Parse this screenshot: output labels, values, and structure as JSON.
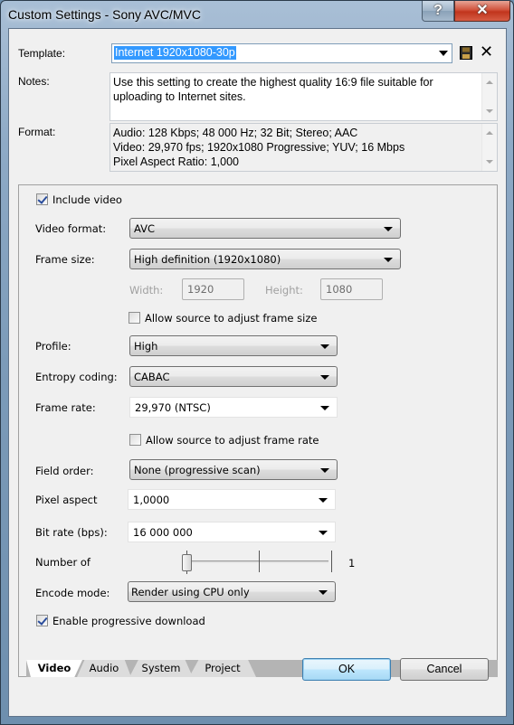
{
  "window": {
    "title": "Custom Settings - Sony AVC/MVC",
    "help_glyph": "?",
    "close_glyph": "✕"
  },
  "template": {
    "label": "Template:",
    "value": "Internet 1920x1080-30p",
    "save_icon": "floppy-disk-icon",
    "delete_icon": "delete-x-icon",
    "delete_glyph": "✕"
  },
  "notes": {
    "label": "Notes:",
    "text": "Use this setting to create the highest quality 16:9 file suitable for uploading to Internet sites."
  },
  "format": {
    "label": "Format:",
    "lines": [
      "Audio: 128 Kbps; 48 000 Hz; 32 Bit; Stereo; AAC",
      "Video: 29,970 fps; 1920x1080 Progressive; YUV; 16 Mbps",
      "Pixel Aspect Ratio: 1,000"
    ]
  },
  "video": {
    "include_video": {
      "label": "Include video",
      "checked": true
    },
    "video_format": {
      "label": "Video format:",
      "value": "AVC"
    },
    "frame_size": {
      "label": "Frame size:",
      "value": "High definition (1920x1080)"
    },
    "width": {
      "label": "Width:",
      "value": "1920"
    },
    "height": {
      "label": "Height:",
      "value": "1080"
    },
    "allow_frame_size": {
      "label": "Allow source to adjust frame size",
      "checked": false
    },
    "profile": {
      "label": "Profile:",
      "value": "High"
    },
    "entropy_coding": {
      "label": "Entropy coding:",
      "value": "CABAC"
    },
    "frame_rate": {
      "label": "Frame rate:",
      "value": "29,970 (NTSC)"
    },
    "allow_frame_rate": {
      "label": "Allow source to adjust frame rate",
      "checked": false
    },
    "field_order": {
      "label": "Field order:",
      "value": "None (progressive scan)"
    },
    "pixel_aspect": {
      "label": "Pixel aspect",
      "value": "1,0000"
    },
    "bit_rate": {
      "label": "Bit rate (bps):",
      "value": "16 000 000"
    },
    "number_of": {
      "label": "Number of",
      "value": "1",
      "slider_position": 0
    },
    "encode_mode": {
      "label": "Encode mode:",
      "value": "Render using CPU only"
    },
    "progressive_download": {
      "label": "Enable progressive download",
      "checked": true
    }
  },
  "tabs": [
    {
      "label": "Video",
      "active": true
    },
    {
      "label": "Audio",
      "active": false
    },
    {
      "label": "System",
      "active": false
    },
    {
      "label": "Project",
      "active": false
    }
  ],
  "buttons": {
    "ok": "OK",
    "cancel": "Cancel"
  }
}
